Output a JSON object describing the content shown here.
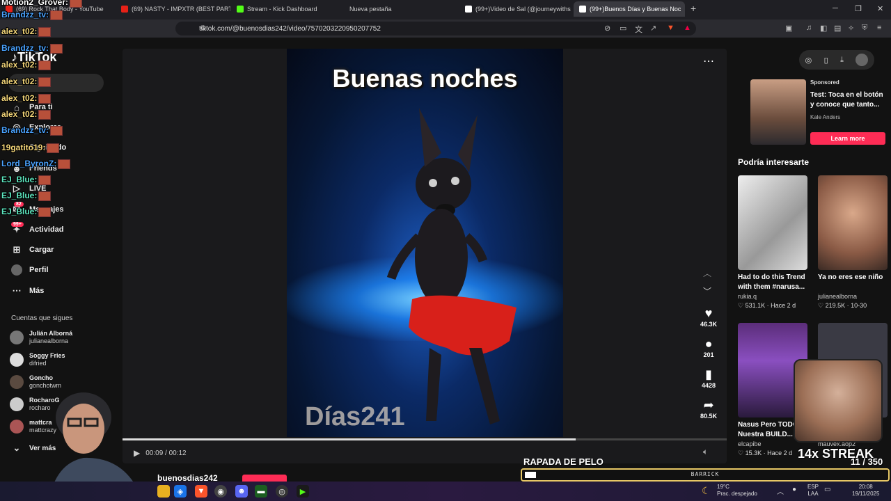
{
  "browser": {
    "tabs": [
      {
        "title": "(69) Rock That Body - YouTube",
        "fav": "#e62117"
      },
      {
        "title": "(69) NASTY - IMPXTR (BEST PART",
        "fav": "#e62117"
      },
      {
        "title": "Stream - Kick Dashboard",
        "fav": "#53fc18"
      },
      {
        "title": "Nueva pestaña",
        "fav": "#444444"
      },
      {
        "title": "(99+)Video de Sal (@journeywithsal)",
        "fav": "#ffffff"
      },
      {
        "title": "(99+)Buenos Días y Buenas Noc",
        "fav": "#ffffff"
      }
    ],
    "url": "tiktok.com/@buenosdias242/video/7570203220950207752"
  },
  "sidebar": {
    "logo": "TikTok",
    "nav": [
      {
        "label": "Para ti",
        "icon": "home-icon"
      },
      {
        "label": "Explorar",
        "icon": "compass-icon"
      },
      {
        "label": "Siguiendo",
        "icon": "following-icon"
      },
      {
        "label": "Friends",
        "icon": "friends-icon"
      },
      {
        "label": "LIVE",
        "icon": "live-icon"
      },
      {
        "label": "Mensajes",
        "icon": "messages-icon"
      },
      {
        "label": "Actividad",
        "icon": "activity-icon"
      },
      {
        "label": "Cargar",
        "icon": "upload-icon"
      },
      {
        "label": "Perfil",
        "icon": "profile-icon"
      },
      {
        "label": "Más",
        "icon": "more-icon"
      }
    ],
    "badges": {
      "messages": "82",
      "activity": "99+"
    },
    "following_header": "Cuentas que sigues",
    "following": [
      {
        "name": "Julián Alborná",
        "handle": "julianealborna"
      },
      {
        "name": "Soggy Fries",
        "handle": "difried"
      },
      {
        "name": "Goncho",
        "handle": "gonchotwm"
      },
      {
        "name": "RocharoG",
        "handle": "rocharo"
      },
      {
        "name": "mattcra",
        "handle": "mattcrazy"
      }
    ],
    "see_more": "Ver más"
  },
  "chat": [
    {
      "user": "Motion2_Grover:",
      "color": "#ffffff"
    },
    {
      "user": "Brandzz_tv:",
      "color": "#4aa3ff"
    },
    {
      "user": "alex_t02:",
      "color": "#f5d77a"
    },
    {
      "user": "Brandzz_tv:",
      "color": "#4aa3ff"
    },
    {
      "user": "alex_t02:",
      "color": "#f5d77a"
    },
    {
      "user": "alex_t02:",
      "color": "#f5d77a"
    },
    {
      "user": "alex_t02:",
      "color": "#f5d77a"
    },
    {
      "user": "alex_t02:",
      "color": "#f5d77a"
    },
    {
      "user": "Brandzz_tv:",
      "color": "#4aa3ff"
    },
    {
      "user": "19gatito19:",
      "color": "#f5d77a"
    },
    {
      "user": "Lord_ByronZ:",
      "color": "#4aa3ff"
    },
    {
      "user": "EJ_Blue:",
      "color": "#5ee8c0"
    },
    {
      "user": "EJ_Blue:",
      "color": "#5ee8c0"
    },
    {
      "user": "EJ_Blue:",
      "color": "#5ee8c0"
    }
  ],
  "video": {
    "title_text": "Buenas noches",
    "watermark": "Días241",
    "time": "00:09 / 00:12",
    "progress": 0.75,
    "actions": [
      {
        "icon": "heart-icon",
        "count": "46.3K"
      },
      {
        "icon": "comment-icon",
        "count": "201"
      },
      {
        "icon": "bookmark-icon",
        "count": "4428"
      },
      {
        "icon": "share-icon",
        "count": "80.5K"
      }
    ],
    "author": "buenosdias242"
  },
  "ad": {
    "sponsored": "Sponsored",
    "title": "Test: Toca en el botón y conoce que tanto...",
    "author": "Kale Anders",
    "cta": "Learn more"
  },
  "recommend": {
    "title": "Podría interesarte",
    "cards": [
      {
        "caption": "Had to do this Trend with them #narusa...",
        "author": "rukia.q",
        "meta": "531.1K · Hace 2 d"
      },
      {
        "caption": "Ya no eres ese niño",
        "author": "julianealborna",
        "meta": "219.5K · 10-30"
      },
      {
        "caption": "Nasus Pero TODO Nuestra BUILD...",
        "author": "elcapibe",
        "meta": "15.3K · Hace 2 d"
      },
      {
        "caption": "",
        "author": "mauvex.aop2",
        "meta": ""
      }
    ]
  },
  "overlay": {
    "goal_title": "RAPADA DE PELO",
    "goal_count": "11 / 350",
    "goal_fraction": 0.0314,
    "goal_label": "BARRICK",
    "streak": "14x STREAK"
  },
  "taskbar": {
    "weather_temp": "19°C",
    "weather_desc": "Prac. despejado",
    "lang": "ESP",
    "lang2": "LAA",
    "time": "20:08",
    "date": "19/11/2025"
  }
}
